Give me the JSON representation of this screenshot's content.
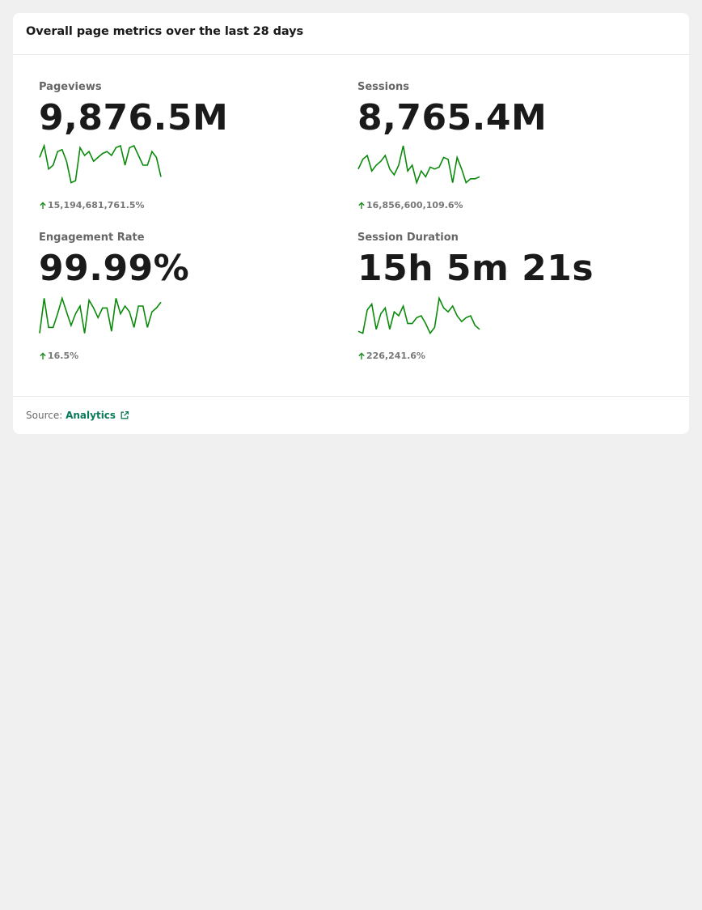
{
  "card": {
    "title": "Overall page metrics over the last 28 days"
  },
  "metrics": [
    {
      "label": "Pageviews",
      "value": "9,876.5M",
      "delta": "15,194,681,761.5%",
      "trend": "up",
      "sparkline": [
        0.7,
        1.0,
        0.4,
        0.5,
        0.85,
        0.9,
        0.6,
        0.05,
        0.1,
        0.95,
        0.75,
        0.85,
        0.6,
        0.7,
        0.8,
        0.85,
        0.75,
        0.95,
        1.0,
        0.5,
        0.95,
        1.0,
        0.75,
        0.5,
        0.5,
        0.85,
        0.7,
        0.2
      ]
    },
    {
      "label": "Sessions",
      "value": "8,765.4M",
      "delta": "16,856,600,109.6%",
      "trend": "up",
      "sparkline": [
        0.4,
        0.65,
        0.75,
        0.35,
        0.5,
        0.6,
        0.75,
        0.4,
        0.25,
        0.5,
        1.0,
        0.35,
        0.5,
        0.05,
        0.35,
        0.2,
        0.45,
        0.4,
        0.45,
        0.7,
        0.65,
        0.05,
        0.7,
        0.4,
        0.05,
        0.15,
        0.15,
        0.2
      ]
    },
    {
      "label": "Engagement Rate",
      "value": "99.99%",
      "delta": "16.5%",
      "trend": "up",
      "sparkline": [
        0.05,
        0.95,
        0.2,
        0.2,
        0.55,
        0.95,
        0.6,
        0.25,
        0.55,
        0.75,
        0.05,
        0.9,
        0.7,
        0.45,
        0.7,
        0.7,
        0.1,
        0.95,
        0.55,
        0.75,
        0.6,
        0.2,
        0.75,
        0.75,
        0.2,
        0.6,
        0.7,
        0.85
      ]
    },
    {
      "label": "Session Duration",
      "value": "15h 5m 21s",
      "delta": "226,241.6%",
      "trend": "up",
      "sparkline": [
        0.1,
        0.05,
        0.65,
        0.8,
        0.15,
        0.55,
        0.7,
        0.15,
        0.6,
        0.5,
        0.75,
        0.3,
        0.3,
        0.45,
        0.5,
        0.3,
        0.05,
        0.2,
        0.95,
        0.7,
        0.6,
        0.75,
        0.5,
        0.35,
        0.45,
        0.5,
        0.25,
        0.15
      ]
    }
  ],
  "footer": {
    "source_prefix": "Source:",
    "source_link": "Analytics"
  },
  "colors": {
    "sparkline": "#0a8a0a",
    "trend_up": "#1f8a1f",
    "link": "#0b7a5a"
  },
  "icons": {
    "trend": "arrow-up-icon",
    "external": "external-link-icon"
  }
}
